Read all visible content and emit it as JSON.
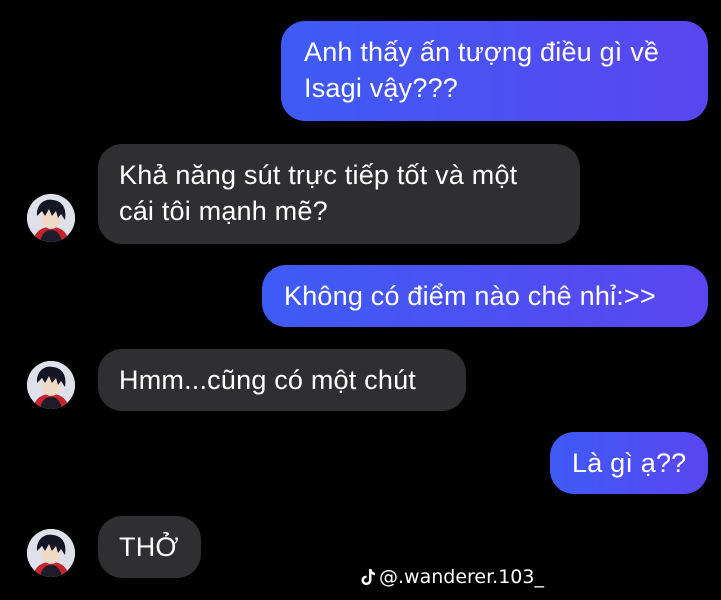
{
  "messages": [
    {
      "sender": "me",
      "text": "Anh thấy ấn tượng điều gì về\nIsagi vậy???"
    },
    {
      "sender": "other",
      "text": "Khả năng sút trực tiếp tốt và một\ncái tôi mạnh mẽ?"
    },
    {
      "sender": "me",
      "text": "Không có điểm nào chê nhỉ:>>"
    },
    {
      "sender": "other",
      "text": "Hmm...cũng có một chút"
    },
    {
      "sender": "me",
      "text": "Là gì ạ??"
    },
    {
      "sender": "other",
      "text": "THỞ"
    }
  ],
  "watermark": {
    "icon": "tiktok-icon",
    "text": "@.wanderer.103_"
  },
  "colors": {
    "background": "#000000",
    "sent_bubble": "#4a52f2",
    "received_bubble": "#2f2f31",
    "text": "#ffffff"
  }
}
